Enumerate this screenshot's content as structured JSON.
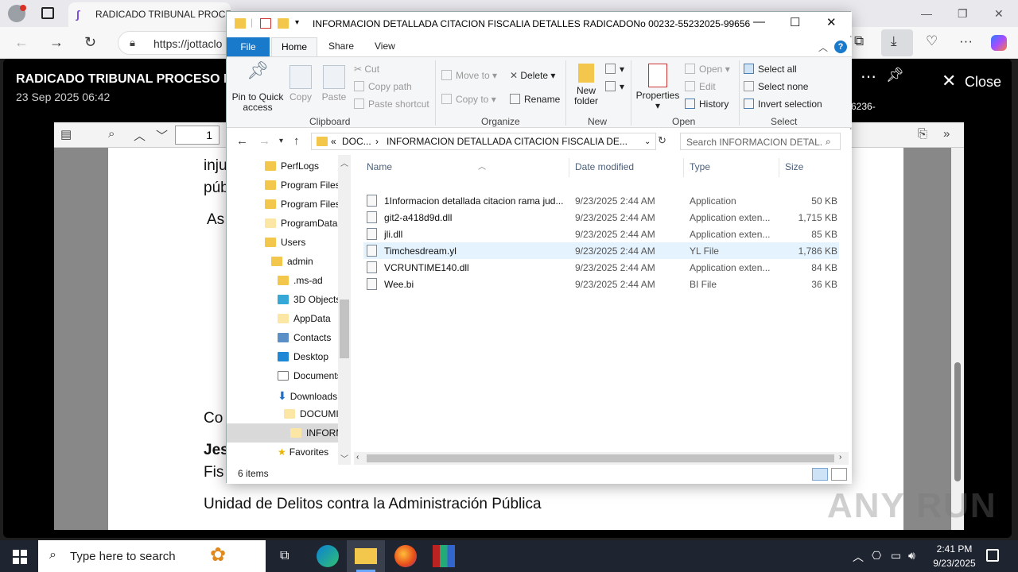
{
  "browser": {
    "tab_title": "RADICADO TRIBUNAL PROCESO",
    "url": "https://jottaclo",
    "colors": {
      "tab_favicon": "#7b4bd8",
      "profile_badge": "#d93025"
    }
  },
  "viewer": {
    "doc_title": "RADICADO TRIBUNAL PROCESO N",
    "doc_date": "23 Sep 2025 06:42",
    "close_label": "Close",
    "page_number": "1",
    "right_fragment": "6236-",
    "page_text": {
      "l1": "inju",
      "l2": "púb",
      "l3": "As",
      "l4": "Co",
      "l5": "Jes",
      "l6": "Fis",
      "l7": "Unidad de Delitos contra la Administración Pública"
    }
  },
  "explorer": {
    "title": "INFORMACION DETALLADA CITACION FISCALIA DETALLES RADICADONo 00232-55232025-99656",
    "tabs": {
      "file": "File",
      "home": "Home",
      "share": "Share",
      "view": "View"
    },
    "ribbon": {
      "pin": "Pin to Quick access",
      "copy": "Copy",
      "paste": "Paste",
      "cut": "Cut",
      "copy_path": "Copy path",
      "paste_shortcut": "Paste shortcut",
      "clipboard": "Clipboard",
      "move_to": "Move to",
      "copy_to": "Copy to",
      "delete": "Delete",
      "rename": "Rename",
      "organize": "Organize",
      "new_folder": "New folder",
      "new": "New",
      "properties": "Properties",
      "open_btn": "Open",
      "edit": "Edit",
      "history": "History",
      "open_group": "Open",
      "select_all": "Select all",
      "select_none": "Select none",
      "invert_selection": "Invert selection",
      "select_group": "Select"
    },
    "address": {
      "crumb1": "DOC...",
      "crumb2": "INFORMACION DETALLADA CITACION FISCALIA DE...",
      "search_placeholder": "Search INFORMACION DETAL..."
    },
    "nav_items": [
      "PerfLogs",
      "Program Files",
      "Program Files",
      "ProgramData",
      "Users",
      "admin",
      ".ms-ad",
      "3D Objects",
      "AppData",
      "Contacts",
      "Desktop",
      "Documents",
      "Downloads",
      "DOCUMI",
      "INFORM",
      "Favorites"
    ],
    "columns": {
      "name": "Name",
      "date": "Date modified",
      "type": "Type",
      "size": "Size"
    },
    "files": [
      {
        "name": "1Informacion detallada citacion rama jud...",
        "date": "9/23/2025 2:44 AM",
        "type": "Application",
        "size": "50 KB"
      },
      {
        "name": "git2-a418d9d.dll",
        "date": "9/23/2025 2:44 AM",
        "type": "Application exten...",
        "size": "1,715 KB"
      },
      {
        "name": "jli.dll",
        "date": "9/23/2025 2:44 AM",
        "type": "Application exten...",
        "size": "85 KB"
      },
      {
        "name": "Timchesdream.yl",
        "date": "9/23/2025 2:44 AM",
        "type": "YL File",
        "size": "1,786 KB"
      },
      {
        "name": "VCRUNTIME140.dll",
        "date": "9/23/2025 2:44 AM",
        "type": "Application exten...",
        "size": "84 KB"
      },
      {
        "name": "Wee.bi",
        "date": "9/23/2025 2:44 AM",
        "type": "BI File",
        "size": "36 KB"
      }
    ],
    "status": "6 items",
    "colors": {
      "file_tab": "#1979ca",
      "selected_row": "#e5f3ff",
      "folder": "#f3c64c"
    }
  },
  "taskbar": {
    "search_placeholder": "Type here to search",
    "time": "2:41 PM",
    "date": "9/23/2025"
  },
  "watermark": "ANY RUN"
}
